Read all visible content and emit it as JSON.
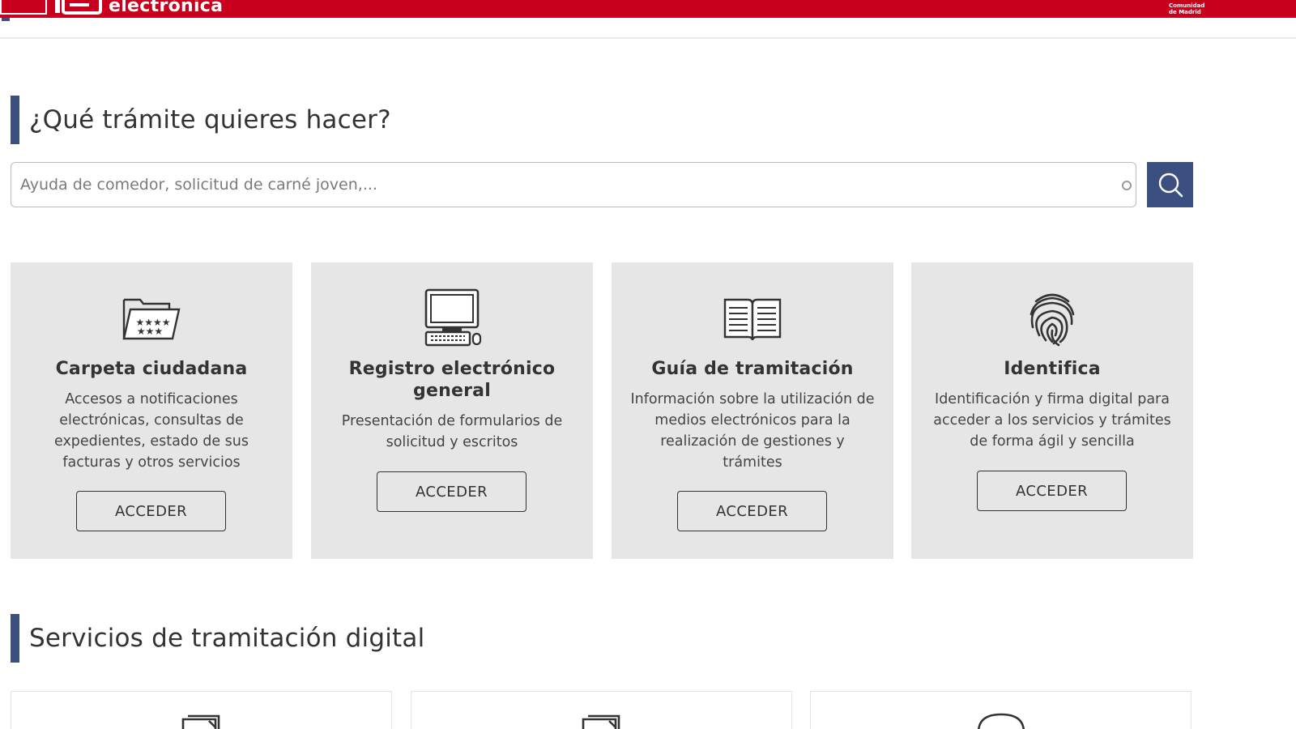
{
  "header": {
    "brand_text": "electrónica",
    "region_line1": "Comunidad",
    "region_line2": "de Madrid"
  },
  "search_section": {
    "title": "¿Qué trámite quieres hacer?",
    "placeholder": "Ayuda de comedor, solicitud de carné joven,..."
  },
  "cards": [
    {
      "icon": "folder-stars-icon",
      "title": "Carpeta ciudadana",
      "description": "Accesos a notificaciones electrónicas, consultas de expedientes, estado de sus facturas y otros servicios",
      "button": "ACCEDER"
    },
    {
      "icon": "computer-icon",
      "title": "Registro electrónico general",
      "description": "Presentación de formularios de solicitud y escritos",
      "button": "ACCEDER"
    },
    {
      "icon": "open-book-icon",
      "title": "Guía de tramitación",
      "description": "Información sobre la utilización de medios electrónicos para la realización de gestiones y trámites",
      "button": "ACCEDER"
    },
    {
      "icon": "fingerprint-icon",
      "title": "Identifica",
      "description": "Identificación y firma digital para acceder a los servicios y trámites de forma ágil y sencilla",
      "button": "ACCEDER"
    }
  ],
  "services_section": {
    "title": "Servicios de tramitación digital"
  },
  "colors": {
    "brand_red": "#c8001d",
    "accent_blue": "#3b4f80",
    "card_bg": "#e6e6e6"
  }
}
